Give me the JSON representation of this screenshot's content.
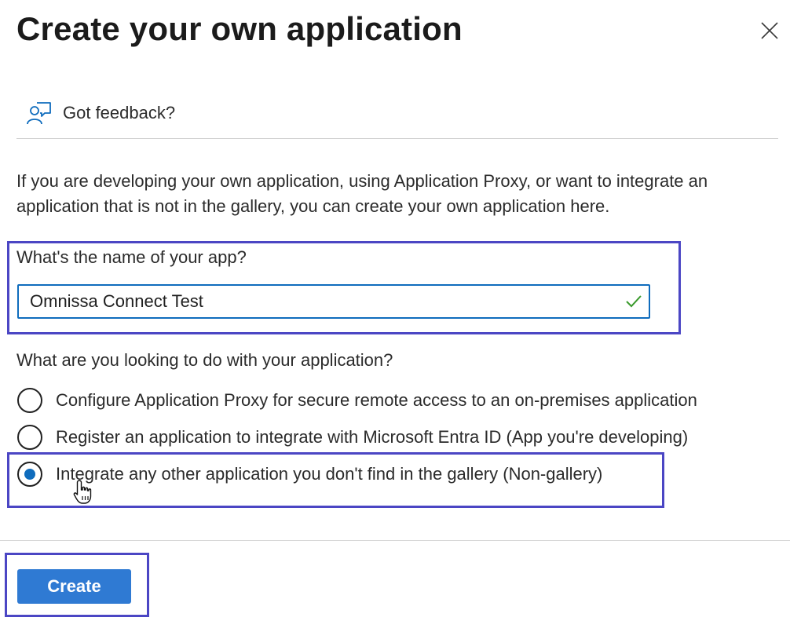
{
  "dialog": {
    "title": "Create your own application",
    "close_icon": "close-icon"
  },
  "feedback": {
    "icon": "feedback-person-icon",
    "label": "Got feedback?"
  },
  "description": "If you are developing your own application, using Application Proxy, or want to integrate an application that is not in the gallery, you can create your own application here.",
  "app_name": {
    "label": "What's the name of your app?",
    "value": "Omnissa Connect Test",
    "valid_icon": "checkmark-icon",
    "valid_color": "#3a9a2c"
  },
  "purpose": {
    "question": "What are you looking to do with your application?",
    "options": [
      {
        "label": "Configure Application Proxy for secure remote access to an on-premises application",
        "selected": false
      },
      {
        "label": "Register an application to integrate with Microsoft Entra ID (App you're developing)",
        "selected": false
      },
      {
        "label": "Integrate any other application you don't find in the gallery (Non-gallery)",
        "selected": true
      }
    ]
  },
  "footer": {
    "create_label": "Create"
  },
  "colors": {
    "accent": "#0f6cbd",
    "button": "#2f7ad3",
    "highlight_border": "#4b46c4"
  }
}
